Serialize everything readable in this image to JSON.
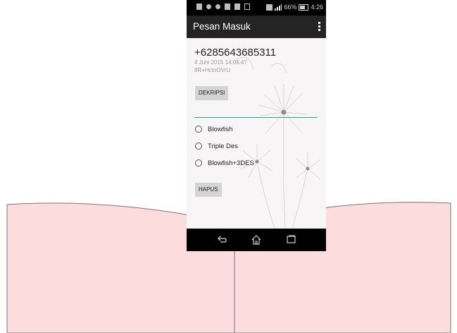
{
  "status_bar": {
    "battery": "66%",
    "time": "4:26"
  },
  "app_bar": {
    "title": "Pesan Masuk"
  },
  "message": {
    "sender": "+6285643685311",
    "date": "4 Juni 2015 14:08:47",
    "text": "8R+HctnOVrU"
  },
  "buttons": {
    "decrypt": "DEKRIPSI",
    "delete": "HAPUS"
  },
  "key_input": {
    "value": ""
  },
  "algorithms": [
    {
      "label": "Blowfish",
      "selected": false
    },
    {
      "label": "Triple Des",
      "selected": false
    },
    {
      "label": "Blowfish+3DES",
      "selected": false
    }
  ],
  "colors": {
    "accent": "#3a9a94",
    "book_page": "#fcdcdc",
    "app_bar": "#242424"
  },
  "icons": [
    "back-icon",
    "home-icon",
    "recent-apps-icon",
    "overflow-menu-icon"
  ]
}
